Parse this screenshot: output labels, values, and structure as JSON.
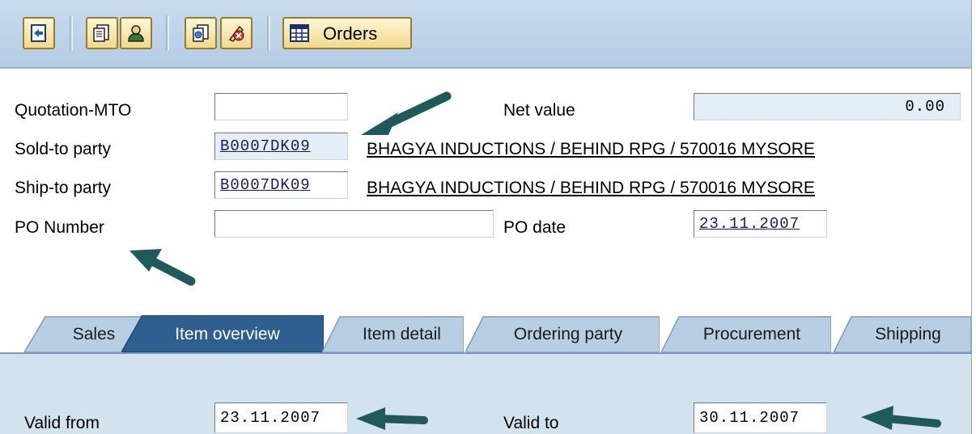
{
  "toolbar": {
    "buttons": [
      {
        "icon": "display-document-icon"
      },
      {
        "icon": "document-header-icon"
      },
      {
        "icon": "partner-person-icon"
      },
      {
        "icon": "document-flow-icon"
      },
      {
        "icon": "delete-edit-icon"
      }
    ],
    "orders_label": "Orders",
    "orders_icon": "table-grid-icon"
  },
  "form": {
    "quotation": {
      "label": "Quotation-MTO",
      "value": ""
    },
    "net_value": {
      "label": "Net value",
      "value": "0.00"
    },
    "sold_to": {
      "label": "Sold-to party",
      "value": "B0007DK09",
      "address": "BHAGYA INDUCTIONS / BEHIND RPG / 570016 MYSORE"
    },
    "ship_to": {
      "label": "Ship-to party",
      "value": "B0007DK09",
      "address": "BHAGYA INDUCTIONS / BEHIND RPG / 570016 MYSORE"
    },
    "po_number": {
      "label": "PO Number",
      "value": ""
    },
    "po_date": {
      "label": "PO date",
      "value": "23.11.2007"
    }
  },
  "tabs": [
    {
      "label": "Sales",
      "active": false
    },
    {
      "label": "Item overview",
      "active": true
    },
    {
      "label": "Item detail",
      "active": false
    },
    {
      "label": "Ordering party",
      "active": false
    },
    {
      "label": "Procurement",
      "active": false
    },
    {
      "label": "Shipping",
      "active": false
    }
  ],
  "item_overview": {
    "valid_from": {
      "label": "Valid from",
      "value": "23.11.2007"
    },
    "valid_to": {
      "label": "Valid to",
      "value": "30.11.2007"
    }
  },
  "colors": {
    "toolbar_bg": "#b3cce4",
    "button_bg": "#f1d98c",
    "active_tab": "#2f5f8f",
    "inactive_tab": "#b7cee3",
    "arrow": "#1f5a5a"
  }
}
